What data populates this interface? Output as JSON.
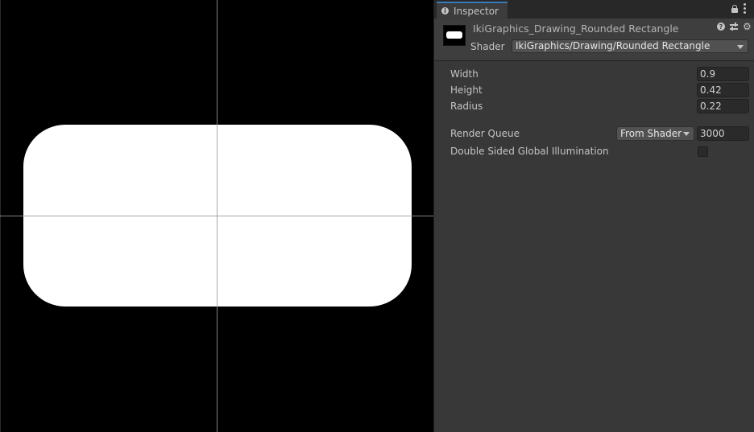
{
  "inspector": {
    "tab_label": "Inspector",
    "material_name": "IkiGraphics_Drawing_Rounded Rectangle",
    "shader_label": "Shader",
    "shader_value": "IkiGraphics/Drawing/Rounded Rectangle",
    "properties": [
      {
        "label": "Width",
        "value": "0.9"
      },
      {
        "label": "Height",
        "value": "0.42"
      },
      {
        "label": "Radius",
        "value": "0.22"
      }
    ],
    "render_queue": {
      "label": "Render Queue",
      "mode": "From Shader",
      "value": "3000"
    },
    "double_sided_gi": {
      "label": "Double Sided Global Illumination",
      "checked": false
    }
  },
  "icons": [
    "info-icon",
    "lock-icon",
    "kebab-menu-icon",
    "help-icon",
    "preset-sliders-icon",
    "gear-icon",
    "dropdown-arrow-icon"
  ]
}
